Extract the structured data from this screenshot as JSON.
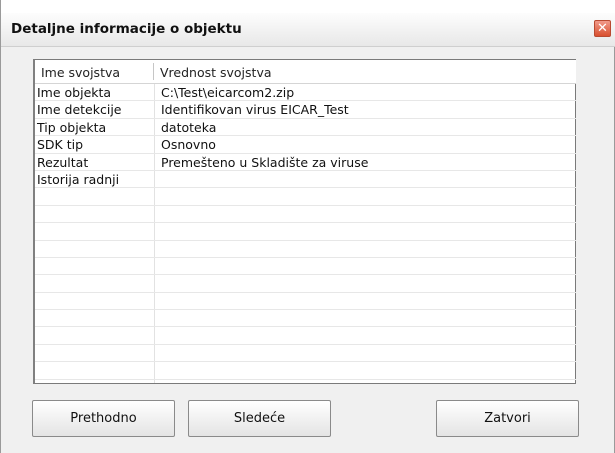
{
  "window": {
    "title": "Detaljne informacije o objektu",
    "close_glyph": "✕"
  },
  "table": {
    "headers": [
      "Ime svojstva",
      "Vrednost svojstva"
    ],
    "rows": [
      [
        "Ime objekta",
        "C:\\Test\\eicarcom2.zip"
      ],
      [
        "Ime detekcije",
        "Identifikovan virus EICAR_Test"
      ],
      [
        "Tip objekta",
        "datoteka"
      ],
      [
        "SDK tip",
        "Osnovno"
      ],
      [
        "Rezultat",
        "Premešteno u Skladište za viruse"
      ],
      [
        "Istorija radnji",
        ""
      ],
      [
        "",
        ""
      ],
      [
        "",
        ""
      ],
      [
        "",
        ""
      ],
      [
        "",
        ""
      ],
      [
        "",
        ""
      ],
      [
        "",
        ""
      ],
      [
        "",
        ""
      ],
      [
        "",
        ""
      ],
      [
        "",
        ""
      ],
      [
        "",
        ""
      ],
      [
        "",
        ""
      ]
    ]
  },
  "buttons": {
    "prev": "Prethodno",
    "next": "Sledeće",
    "close": "Zatvori"
  },
  "colors": {
    "close_button": "#d9502f",
    "border": "#7a7a7a"
  }
}
